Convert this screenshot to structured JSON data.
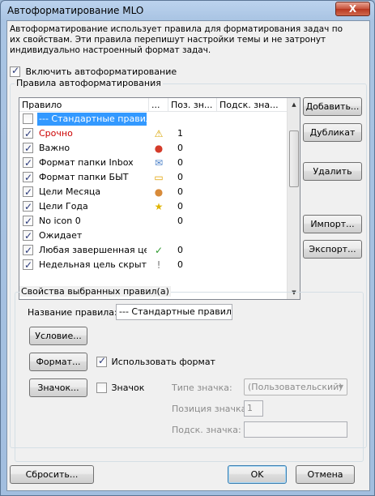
{
  "window": {
    "title": "Автоформатирование MLO",
    "close_label": "X"
  },
  "description": "Автоформатирование использует правила для форматирования задач по их свойствам. Эти правила перепишут настройки темы и не затронут индивидуально настроенный формат задач.",
  "enable": {
    "label": "Включить автоформатирование",
    "checked": true
  },
  "rules_group": {
    "title": "Правила автоформатирования",
    "columns": [
      "Правило",
      "...",
      "Поз. зн...",
      "Подск. зна..."
    ],
    "rows": [
      {
        "name": "--- Стандартные правил...",
        "checked": false,
        "icon": "",
        "pos": "",
        "selected": true,
        "color": "#ffffff"
      },
      {
        "name": "Срочно",
        "checked": true,
        "icon": "warning-icon",
        "pos": "1",
        "color": "#cc0000"
      },
      {
        "name": "Важно",
        "checked": true,
        "icon": "important-icon",
        "pos": "0",
        "color": "#000000"
      },
      {
        "name": "Формат папки Inbox",
        "checked": true,
        "icon": "envelope-icon",
        "pos": "0",
        "color": "#000000"
      },
      {
        "name": "Формат папки БЫТ",
        "checked": true,
        "icon": "folder-icon",
        "pos": "0",
        "color": "#000000"
      },
      {
        "name": "Цели Месяца",
        "checked": true,
        "icon": "medal-icon",
        "pos": "0",
        "color": "#000000"
      },
      {
        "name": "Цели Года",
        "checked": true,
        "icon": "star-icon",
        "pos": "0",
        "color": "#000000"
      },
      {
        "name": "No icon 0",
        "checked": true,
        "icon": "",
        "pos": "0",
        "color": "#000000"
      },
      {
        "name": "Ожидает",
        "checked": true,
        "icon": "",
        "pos": "",
        "color": "#000000"
      },
      {
        "name": "Любая завершенная це...",
        "checked": true,
        "icon": "checkmark-icon",
        "pos": "0",
        "color": "#000000"
      },
      {
        "name": "Недельная цель скрыта",
        "checked": true,
        "icon": "exclamation-icon",
        "pos": "0",
        "color": "#000000"
      }
    ],
    "buttons": {
      "add": "Добавить...",
      "duplicate": "Дубликат",
      "delete": "Удалить",
      "import": "Импорт...",
      "export": "Экспорт..."
    }
  },
  "props_group": {
    "title": "Свойства выбранных правил(а)",
    "rule_name_label": "Название правила:",
    "rule_name_value": "--- Стандартные правила ---",
    "condition_button": "Условие...",
    "format_button": "Формат...",
    "use_format_label": "Использовать формат",
    "use_format_checked": true,
    "icon_button": "Значок...",
    "icon_checkbox_label": "Значок",
    "icon_checked": false,
    "icon_type_label": "Типе значка:",
    "icon_type_value": "(Пользовательский)",
    "icon_position_label": "Позиция значка:",
    "icon_position_value": "1",
    "icon_hint_label": "Подск. значка:",
    "icon_hint_value": ""
  },
  "footer": {
    "reset": "Сбросить...",
    "ok": "OK",
    "cancel": "Отмена"
  }
}
